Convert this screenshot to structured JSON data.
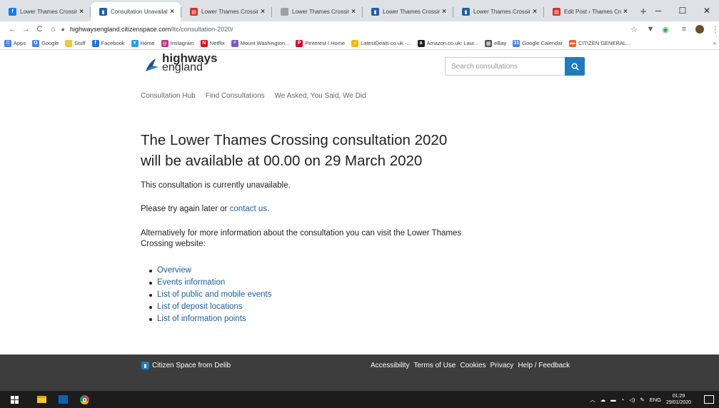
{
  "browser": {
    "tabs": [
      {
        "title": "Lower Thames Crossin",
        "favicon": "facebook-favicon",
        "color": "#1877f2",
        "glyph": "f",
        "active": false
      },
      {
        "title": "Consultation Unavailal",
        "favicon": "delib-favicon",
        "color": "#1f5fa8",
        "glyph": "▮",
        "active": true
      },
      {
        "title": "Lower Thames Crossin",
        "favicon": "red-favicon",
        "color": "#d93025",
        "glyph": "▤",
        "active": false
      },
      {
        "title": "Lower Thames Crossin",
        "favicon": "page-favicon",
        "color": "#9aa0a6",
        "glyph": "",
        "active": false
      },
      {
        "title": "Lower Thames Crossin",
        "favicon": "delib-favicon",
        "color": "#1f5fa8",
        "glyph": "▮",
        "active": false
      },
      {
        "title": "Lower Thames Crossin",
        "favicon": "delib-favicon",
        "color": "#1f5fa8",
        "glyph": "▮",
        "active": false
      },
      {
        "title": "Edit Post ‹ Thames Cro",
        "favicon": "red-favicon",
        "color": "#d93025",
        "glyph": "▤",
        "active": false
      }
    ],
    "url_host": "highwaysengland.citizenspace.com",
    "url_path": "/ltc/consultation-2020/",
    "bookmarks": [
      {
        "label": "Apps",
        "icon": "apps-grid-icon",
        "color": "#4285f4",
        "glyph": "⁞⁞"
      },
      {
        "label": "Google",
        "icon": "google-icon",
        "color": "#4285f4",
        "glyph": "G"
      },
      {
        "label": "Stuff",
        "icon": "folder-icon",
        "color": "#f4c542",
        "glyph": ""
      },
      {
        "label": "Facebook",
        "icon": "facebook-icon",
        "color": "#1877f2",
        "glyph": "f"
      },
      {
        "label": "Home",
        "icon": "twitter-icon",
        "color": "#1da1f2",
        "glyph": "♥"
      },
      {
        "label": "Instagram",
        "icon": "instagram-icon",
        "color": "#c13584",
        "glyph": "◎"
      },
      {
        "label": "Netflix",
        "icon": "netflix-icon",
        "color": "#e50914",
        "glyph": "N"
      },
      {
        "label": "Mount Washington...",
        "icon": "mountain-icon",
        "color": "#7a5cc2",
        "glyph": "ᵒ"
      },
      {
        "label": "Pinterest / Home",
        "icon": "pinterest-icon",
        "color": "#e60023",
        "glyph": "P"
      },
      {
        "label": "LatestDeals.co.uk -...",
        "icon": "bolt-icon",
        "color": "#f5b700",
        "glyph": "⚡"
      },
      {
        "label": "Amazon.co.uk: Laur...",
        "icon": "amazon-icon",
        "color": "#222222",
        "glyph": "a"
      },
      {
        "label": "eBay",
        "icon": "ebay-icon",
        "color": "#555555",
        "glyph": "▦"
      },
      {
        "label": "Google Calendar",
        "icon": "calendar-icon",
        "color": "#4285f4",
        "glyph": "31"
      },
      {
        "label": "CITIZEN GENERAL...",
        "icon": "citizen-icon",
        "color": "#e8632b",
        "glyph": "▬"
      }
    ],
    "more_bookmarks": "»"
  },
  "site": {
    "logo_line1": "highways",
    "logo_line2": "england",
    "search_placeholder": "Search consultations",
    "nav": [
      "Consultation Hub",
      "Find Consultations",
      "We Asked, You Said, We Did"
    ]
  },
  "content": {
    "heading_line1": "The Lower Thames Crossing consultation 2020",
    "heading_line2": "will be available at 00.00 on 29 March 2020",
    "unavailable": "This consultation is currently unavailable.",
    "try_again_prefix": "Please try again later or ",
    "contact_link": "contact us",
    "try_again_suffix": ".",
    "alternatively": "Alternatively for more information about the consultation you can visit the Lower Thames Crossing website:",
    "links": [
      "Overview",
      "Events information",
      "List of public and mobile events",
      "List of deposit locations",
      "List of information points"
    ]
  },
  "footer": {
    "brand": "Citizen Space from Delib",
    "links": [
      "Accessibility",
      "Terms of Use",
      "Cookies",
      "Privacy",
      "Help / Feedback"
    ]
  },
  "taskbar": {
    "language": "ENG",
    "time": "01:29",
    "date": "29/01/2020"
  }
}
